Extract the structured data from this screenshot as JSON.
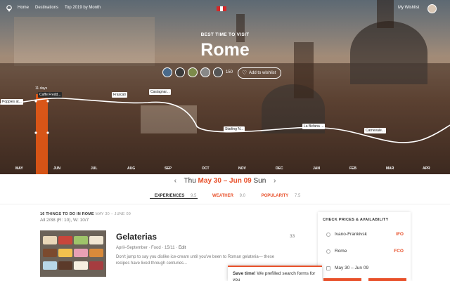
{
  "topnav": {
    "links": [
      "Home",
      "Destinations",
      "Top 2019 by Month"
    ],
    "wishlist": "My Wishlist"
  },
  "hero": {
    "kicker": "BEST TIME TO VISIT",
    "city": "Rome",
    "social_count": "150",
    "wishlist_button": "Add to wishlist",
    "days_label": "11 days"
  },
  "timeline": {
    "tags": [
      "Poppies at...",
      "Caffe Fredd...",
      "Frascati",
      "Castagnar...",
      "Starling N...",
      "La Befana ...",
      "Carnevale..."
    ],
    "months": [
      "MAY",
      "JUN",
      "JUL",
      "AUG",
      "SEP",
      "OCT",
      "NOV",
      "DEC",
      "JAN",
      "FEB",
      "MAR",
      "APR"
    ]
  },
  "datebar": {
    "prefix": "Thu",
    "range_start": "May 30",
    "dash": "–",
    "range_end": "Jun 09",
    "suffix": "Sun"
  },
  "scores": {
    "experiences_label": "EXPERIENCES",
    "experiences_value": "9.5",
    "weather_label": "WEATHER",
    "weather_value": "9.0",
    "popularity_label": "POPULARITY",
    "popularity_value": "7.5"
  },
  "things": {
    "heading": "16 THINGS TO DO IN ROME",
    "heading_dates": "MAY 30 – JUNE 09",
    "subheading": "All 2/88 (R: 10), W: 10/7",
    "item": {
      "title": "Gelaterias",
      "meta": "April–September · Food · 15/11 ·",
      "edit": "Edit",
      "description": "Don't jump to say you dislike ice-cream until you've been to Roman gelateria— these recipes have lived through centuries...",
      "count": "33"
    }
  },
  "panel": {
    "heading": "CHECK PRICES & AVAILABILITY",
    "rows": [
      {
        "label": "Ivano-Frankivsk",
        "code": "IFO"
      },
      {
        "label": "Rome",
        "code": "FCO"
      },
      {
        "label": "May 30 – Jun 09",
        "code": ""
      }
    ]
  },
  "toast": {
    "bold": "Save time!",
    "text": "We prefilled search forms for you"
  },
  "colors": {
    "accent": "#e8502a",
    "selection_band": "#f05a14"
  }
}
